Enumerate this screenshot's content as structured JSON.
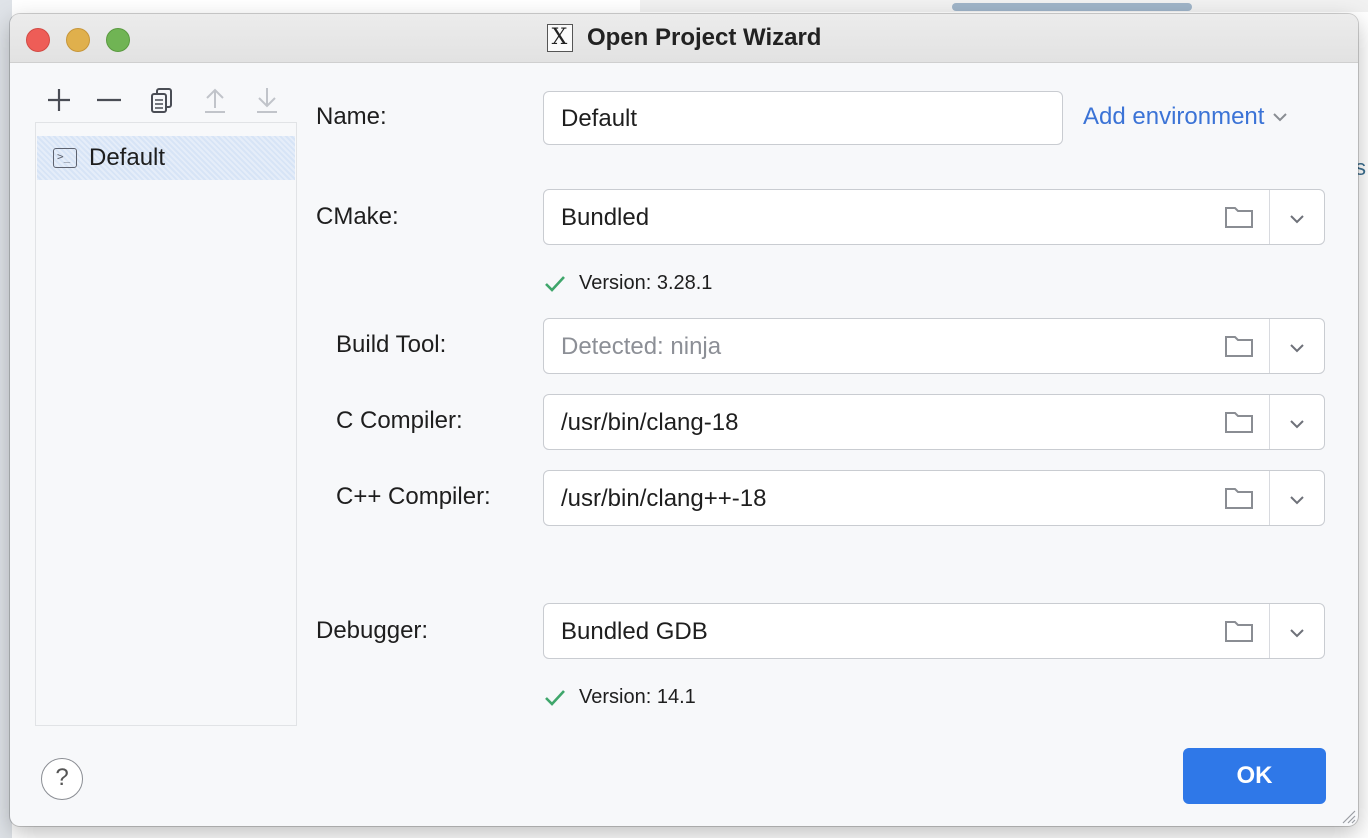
{
  "window": {
    "title": "Open Project Wizard"
  },
  "sidebar": {
    "items": [
      {
        "label": "Default",
        "icon": "terminal-icon"
      }
    ],
    "toolbar_icons": [
      "add-icon",
      "remove-icon",
      "copy-icon",
      "move-up-icon",
      "move-down-icon"
    ]
  },
  "form": {
    "name": {
      "label": "Name:",
      "value": "Default"
    },
    "add_environment": "Add environment",
    "cmake": {
      "label": "CMake:",
      "value": "Bundled",
      "version": "Version: 3.28.1"
    },
    "build_tool": {
      "label": "Build Tool:",
      "placeholder": "Detected: ninja"
    },
    "c_compiler": {
      "label": "C Compiler:",
      "value": "/usr/bin/clang-18"
    },
    "cpp_compiler": {
      "label": "C++ Compiler:",
      "value": "/usr/bin/clang++-18"
    },
    "debugger": {
      "label": "Debugger:",
      "value": "Bundled GDB",
      "version": "Version: 14.1"
    }
  },
  "footer": {
    "help": "?",
    "ok": "OK"
  },
  "colors": {
    "accent": "#2f78e8",
    "link": "#3b73d6",
    "success": "#3fa66b",
    "selection": "#d7e4f6"
  }
}
